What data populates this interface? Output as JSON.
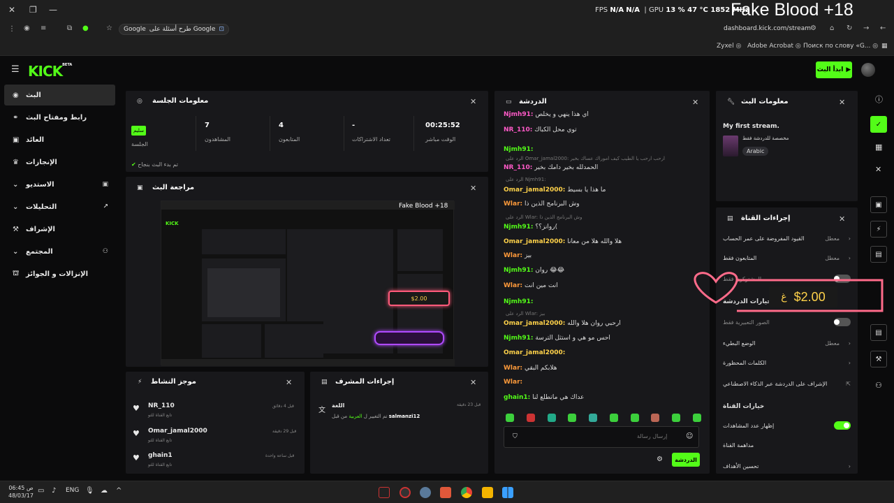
{
  "browser": {
    "fps_label": "FPS",
    "fps_value": "N/A",
    "fps_value2": "N/A",
    "gpu_label": "GPU",
    "gpu_stats": "13 % 47 °C 1852 MHz",
    "overlay_title": "Fake Blood +18",
    "search_chip": "طرح أسئلة على Google",
    "url": "dashboard.kick.com/stream",
    "bookmarks": [
      "Zyxel",
      "Adobe Acrobat",
      "Поиск по слову «G..."
    ]
  },
  "header": {
    "logo": "KICK",
    "beta": "BETA",
    "go_live": "ابدأ البث"
  },
  "sidebar": {
    "items": [
      {
        "label": "البث"
      },
      {
        "label": "رابط ومفتاح البث"
      },
      {
        "label": "العائد"
      },
      {
        "label": "الإنجازات"
      },
      {
        "label": "الاستديو"
      },
      {
        "label": "التحليلات"
      },
      {
        "label": "الإشراف"
      },
      {
        "label": "المجتمع"
      },
      {
        "label": "الإنزالات و الجوائز"
      }
    ]
  },
  "session": {
    "title": "معلومات الجلسة",
    "live_time": "00:25:52",
    "live_time_label": "الوقت مباشر",
    "subs": "-",
    "subs_label": "تعداد الاشتراكات",
    "followers": "4",
    "followers_label": "المتابعون",
    "viewers": "7",
    "viewers_label": "المشاهدون",
    "session_badge": "سليم",
    "session_label": "الجلسة",
    "status": "تم بدء البث بنجاح"
  },
  "preview": {
    "title": "مراجعة البث",
    "mini_title": "Fake Blood +18",
    "mini_amount": "$2.00"
  },
  "activity": {
    "title": "موجز النشاط",
    "items": [
      {
        "user": "NR_110",
        "desc": "تابع القناة للتو",
        "time": "قبل 4 دقائق"
      },
      {
        "user": "Omar_jamal2000",
        "desc": "تابع القناة للتو",
        "time": "قبل 29 دقيقة"
      },
      {
        "user": "ghain1",
        "desc": "تابع القناة للتو",
        "time": "قبل ساعة واحدة"
      }
    ]
  },
  "mod": {
    "title": "إجراءات المشرف",
    "item_title": "اللغة",
    "item_desc_prefix": "تم التغيير ل",
    "item_lang": "العربية",
    "item_by": "من قبل",
    "item_user": "salmanzi12",
    "item_time": "قبل 23 دقيقة"
  },
  "chat": {
    "title": "الدردشة",
    "messages": [
      {
        "user": "Njmh91:",
        "text": "اي هذا ينهي و يخلص",
        "color": "#ff5ac8"
      },
      {
        "user": "NR_110:",
        "text": "توي محل الكباك",
        "color": "#ff5ac8"
      },
      {
        "user": "Njmh91:",
        "text": "",
        "color": "#53fc18"
      },
      {
        "reply": "الرد على Omar_jamal2000: ارحب ارحب يا الطيب كيف اموراك عساك بخير"
      },
      {
        "user": "NR_110:",
        "text": "الحمدلله بخير دامك بخير",
        "color": "#ff5ac8"
      },
      {
        "reply": "الرد على Njmh91:"
      },
      {
        "user": "Omar_jamal2000:",
        "text": "ما هذا يا بسيط",
        "color": "#ffd24a"
      },
      {
        "user": "Wlar:",
        "text": "وش البرنامج الذين ذا",
        "color": "#ff9a3a"
      },
      {
        "reply": "الرد على Wlar: وش البرنامج الذين ذا"
      },
      {
        "user": "Njmh91:",
        "text": "روانز؟؟(",
        "color": "#53fc18"
      },
      {
        "user": "Omar_jamal2000:",
        "text": "هلا والله هلا من معانا",
        "color": "#ffd24a"
      },
      {
        "user": "Wlar:",
        "text": "بيز",
        "color": "#ff9a3a"
      },
      {
        "user": "Njmh91:",
        "text": "روان 😂😂",
        "color": "#53fc18"
      },
      {
        "user": "Wlar:",
        "text": "انت مين انت",
        "color": "#ff9a3a"
      },
      {
        "user": "Njmh91:",
        "text": "",
        "color": "#53fc18"
      },
      {
        "reply": "الرد على Wlar: بيز"
      },
      {
        "user": "Omar_jamal2000:",
        "text": "ارحبي روان هلا والله",
        "color": "#ffd24a"
      },
      {
        "user": "Njmh91:",
        "text": "احس مو هي و استثل الترسة",
        "color": "#53fc18"
      },
      {
        "user": "Omar_jamal2000:",
        "text": "",
        "color": "#ffd24a"
      },
      {
        "user": "Wlar:",
        "text": "هلابكم البقي",
        "color": "#ff9a3a"
      },
      {
        "user": "Wlar:",
        "text": "",
        "color": "#ff9a3a"
      },
      {
        "user": "ghain1:",
        "text": "عداك هي ماتطلع لنا",
        "color": "#53fc18"
      }
    ],
    "input_placeholder": "إرسال رسالة",
    "send": "الدردشة"
  },
  "stream_info": {
    "title": "معلومات البث",
    "stream_title": "My first stream.",
    "category": "مخصصة للدردشة فقط",
    "language": "Arabic"
  },
  "channel": {
    "title": "إجراءات القناة",
    "rows": [
      {
        "label": "القيود المفروضة على عمر الحساب",
        "state": "معطل"
      },
      {
        "label": "المتابعون فقط",
        "state": "معطل"
      },
      {
        "label": "المشتركون فقط",
        "state": ""
      },
      {
        "label": "خيارات الدردشة",
        "state": ""
      },
      {
        "label": "الصور التعبيرية فقط",
        "state": ""
      },
      {
        "label": "الوضع البطيء",
        "state": "معطل"
      },
      {
        "label": "الكلمات المحظورة",
        "state": ""
      },
      {
        "label": "الإشراف على الدردشة عبر الذكاء الاصطناعي",
        "state": ""
      }
    ],
    "options_title": "خيارات القناة",
    "show_viewers": "إظهار عدد المشاهدات",
    "share": "مداهمة القناة",
    "goals": "تحسين الأهداف"
  },
  "donation": {
    "amount": "$2.00",
    "symbol": "غ"
  },
  "taskbar": {
    "time": "06:45 ص",
    "date": "48/03/17",
    "lang": "ENG"
  }
}
